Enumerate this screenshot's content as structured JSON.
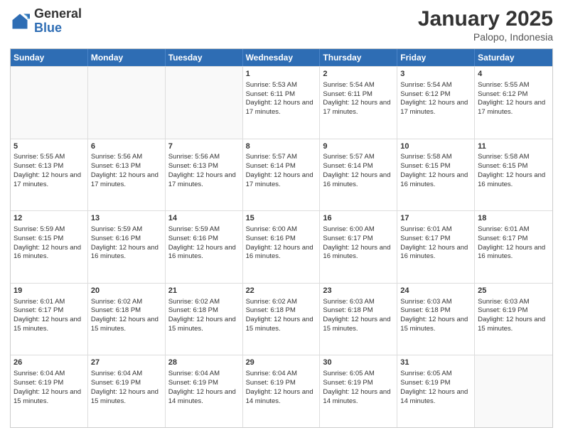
{
  "header": {
    "logo_general": "General",
    "logo_blue": "Blue",
    "month_year": "January 2025",
    "location": "Palopo, Indonesia"
  },
  "days_of_week": [
    "Sunday",
    "Monday",
    "Tuesday",
    "Wednesday",
    "Thursday",
    "Friday",
    "Saturday"
  ],
  "weeks": [
    [
      {
        "day": "",
        "sunrise": "",
        "sunset": "",
        "daylight": ""
      },
      {
        "day": "",
        "sunrise": "",
        "sunset": "",
        "daylight": ""
      },
      {
        "day": "",
        "sunrise": "",
        "sunset": "",
        "daylight": ""
      },
      {
        "day": "1",
        "sunrise": "Sunrise: 5:53 AM",
        "sunset": "Sunset: 6:11 PM",
        "daylight": "Daylight: 12 hours and 17 minutes."
      },
      {
        "day": "2",
        "sunrise": "Sunrise: 5:54 AM",
        "sunset": "Sunset: 6:11 PM",
        "daylight": "Daylight: 12 hours and 17 minutes."
      },
      {
        "day": "3",
        "sunrise": "Sunrise: 5:54 AM",
        "sunset": "Sunset: 6:12 PM",
        "daylight": "Daylight: 12 hours and 17 minutes."
      },
      {
        "day": "4",
        "sunrise": "Sunrise: 5:55 AM",
        "sunset": "Sunset: 6:12 PM",
        "daylight": "Daylight: 12 hours and 17 minutes."
      }
    ],
    [
      {
        "day": "5",
        "sunrise": "Sunrise: 5:55 AM",
        "sunset": "Sunset: 6:13 PM",
        "daylight": "Daylight: 12 hours and 17 minutes."
      },
      {
        "day": "6",
        "sunrise": "Sunrise: 5:56 AM",
        "sunset": "Sunset: 6:13 PM",
        "daylight": "Daylight: 12 hours and 17 minutes."
      },
      {
        "day": "7",
        "sunrise": "Sunrise: 5:56 AM",
        "sunset": "Sunset: 6:13 PM",
        "daylight": "Daylight: 12 hours and 17 minutes."
      },
      {
        "day": "8",
        "sunrise": "Sunrise: 5:57 AM",
        "sunset": "Sunset: 6:14 PM",
        "daylight": "Daylight: 12 hours and 17 minutes."
      },
      {
        "day": "9",
        "sunrise": "Sunrise: 5:57 AM",
        "sunset": "Sunset: 6:14 PM",
        "daylight": "Daylight: 12 hours and 16 minutes."
      },
      {
        "day": "10",
        "sunrise": "Sunrise: 5:58 AM",
        "sunset": "Sunset: 6:15 PM",
        "daylight": "Daylight: 12 hours and 16 minutes."
      },
      {
        "day": "11",
        "sunrise": "Sunrise: 5:58 AM",
        "sunset": "Sunset: 6:15 PM",
        "daylight": "Daylight: 12 hours and 16 minutes."
      }
    ],
    [
      {
        "day": "12",
        "sunrise": "Sunrise: 5:59 AM",
        "sunset": "Sunset: 6:15 PM",
        "daylight": "Daylight: 12 hours and 16 minutes."
      },
      {
        "day": "13",
        "sunrise": "Sunrise: 5:59 AM",
        "sunset": "Sunset: 6:16 PM",
        "daylight": "Daylight: 12 hours and 16 minutes."
      },
      {
        "day": "14",
        "sunrise": "Sunrise: 5:59 AM",
        "sunset": "Sunset: 6:16 PM",
        "daylight": "Daylight: 12 hours and 16 minutes."
      },
      {
        "day": "15",
        "sunrise": "Sunrise: 6:00 AM",
        "sunset": "Sunset: 6:16 PM",
        "daylight": "Daylight: 12 hours and 16 minutes."
      },
      {
        "day": "16",
        "sunrise": "Sunrise: 6:00 AM",
        "sunset": "Sunset: 6:17 PM",
        "daylight": "Daylight: 12 hours and 16 minutes."
      },
      {
        "day": "17",
        "sunrise": "Sunrise: 6:01 AM",
        "sunset": "Sunset: 6:17 PM",
        "daylight": "Daylight: 12 hours and 16 minutes."
      },
      {
        "day": "18",
        "sunrise": "Sunrise: 6:01 AM",
        "sunset": "Sunset: 6:17 PM",
        "daylight": "Daylight: 12 hours and 16 minutes."
      }
    ],
    [
      {
        "day": "19",
        "sunrise": "Sunrise: 6:01 AM",
        "sunset": "Sunset: 6:17 PM",
        "daylight": "Daylight: 12 hours and 15 minutes."
      },
      {
        "day": "20",
        "sunrise": "Sunrise: 6:02 AM",
        "sunset": "Sunset: 6:18 PM",
        "daylight": "Daylight: 12 hours and 15 minutes."
      },
      {
        "day": "21",
        "sunrise": "Sunrise: 6:02 AM",
        "sunset": "Sunset: 6:18 PM",
        "daylight": "Daylight: 12 hours and 15 minutes."
      },
      {
        "day": "22",
        "sunrise": "Sunrise: 6:02 AM",
        "sunset": "Sunset: 6:18 PM",
        "daylight": "Daylight: 12 hours and 15 minutes."
      },
      {
        "day": "23",
        "sunrise": "Sunrise: 6:03 AM",
        "sunset": "Sunset: 6:18 PM",
        "daylight": "Daylight: 12 hours and 15 minutes."
      },
      {
        "day": "24",
        "sunrise": "Sunrise: 6:03 AM",
        "sunset": "Sunset: 6:18 PM",
        "daylight": "Daylight: 12 hours and 15 minutes."
      },
      {
        "day": "25",
        "sunrise": "Sunrise: 6:03 AM",
        "sunset": "Sunset: 6:19 PM",
        "daylight": "Daylight: 12 hours and 15 minutes."
      }
    ],
    [
      {
        "day": "26",
        "sunrise": "Sunrise: 6:04 AM",
        "sunset": "Sunset: 6:19 PM",
        "daylight": "Daylight: 12 hours and 15 minutes."
      },
      {
        "day": "27",
        "sunrise": "Sunrise: 6:04 AM",
        "sunset": "Sunset: 6:19 PM",
        "daylight": "Daylight: 12 hours and 15 minutes."
      },
      {
        "day": "28",
        "sunrise": "Sunrise: 6:04 AM",
        "sunset": "Sunset: 6:19 PM",
        "daylight": "Daylight: 12 hours and 14 minutes."
      },
      {
        "day": "29",
        "sunrise": "Sunrise: 6:04 AM",
        "sunset": "Sunset: 6:19 PM",
        "daylight": "Daylight: 12 hours and 14 minutes."
      },
      {
        "day": "30",
        "sunrise": "Sunrise: 6:05 AM",
        "sunset": "Sunset: 6:19 PM",
        "daylight": "Daylight: 12 hours and 14 minutes."
      },
      {
        "day": "31",
        "sunrise": "Sunrise: 6:05 AM",
        "sunset": "Sunset: 6:19 PM",
        "daylight": "Daylight: 12 hours and 14 minutes."
      },
      {
        "day": "",
        "sunrise": "",
        "sunset": "",
        "daylight": ""
      }
    ]
  ]
}
